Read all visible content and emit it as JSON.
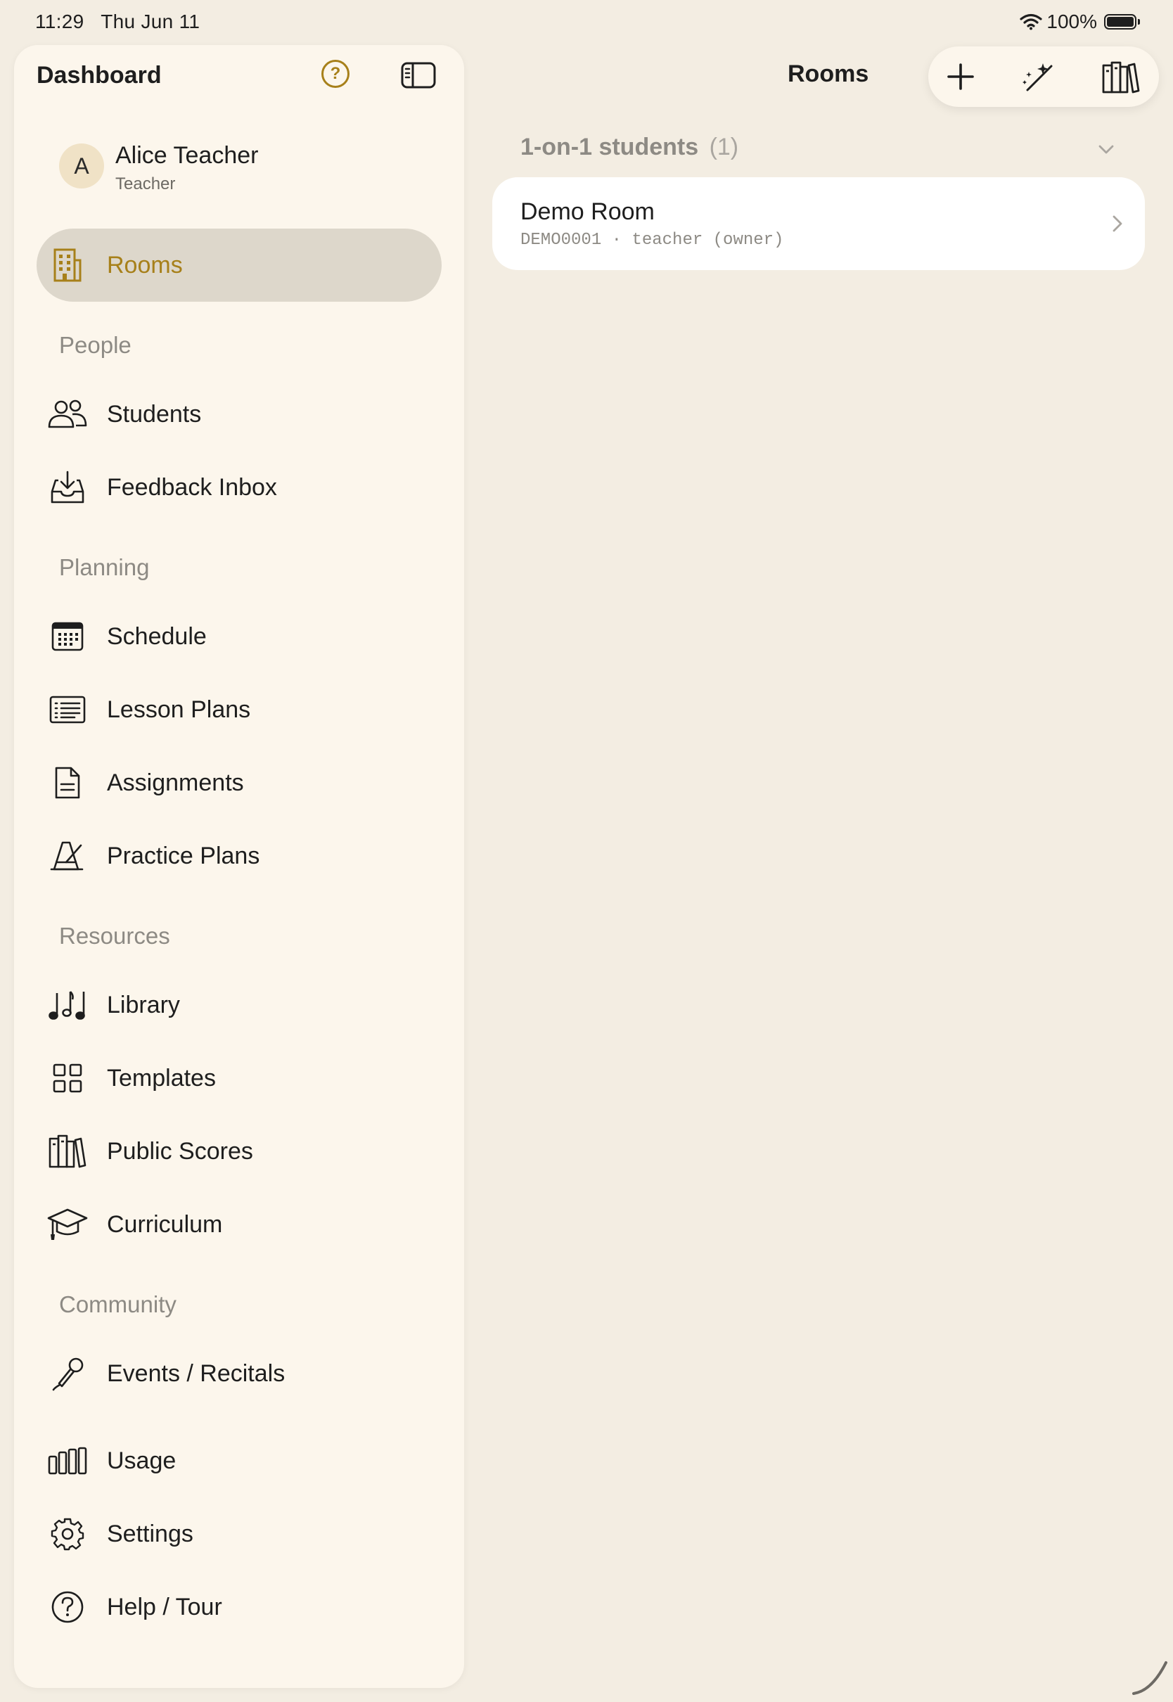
{
  "status_bar": {
    "time": "11:29",
    "date": "Thu Jun 11",
    "battery": "100%"
  },
  "sidebar": {
    "title": "Dashboard",
    "help_glyph": "?",
    "profile": {
      "initial": "A",
      "name": "Alice Teacher",
      "role": "Teacher"
    },
    "rooms": {
      "label": "Rooms",
      "icon": "building-icon"
    },
    "sections": {
      "people": "People",
      "planning": "Planning",
      "resources": "Resources",
      "community": "Community"
    },
    "items": {
      "students": "Students",
      "feedback_inbox": "Feedback Inbox",
      "schedule": "Schedule",
      "lesson_plans": "Lesson Plans",
      "assignments": "Assignments",
      "practice_plans": "Practice Plans",
      "library": "Library",
      "templates": "Templates",
      "public_scores": "Public Scores",
      "curriculum": "Curriculum",
      "events_recitals": "Events / Recitals",
      "usage": "Usage",
      "settings": "Settings",
      "help_tour": "Help / Tour"
    },
    "accent_color": "#a7801a"
  },
  "main": {
    "title": "Rooms",
    "toolbar": {
      "add": "plus-icon",
      "magic": "magic-wand-icon",
      "library": "books-icon"
    },
    "group": {
      "title": "1-on-1 students",
      "count": "(1)"
    },
    "rooms": [
      {
        "name": "Demo Room",
        "meta": "DEMO0001 · teacher (owner)"
      }
    ]
  }
}
